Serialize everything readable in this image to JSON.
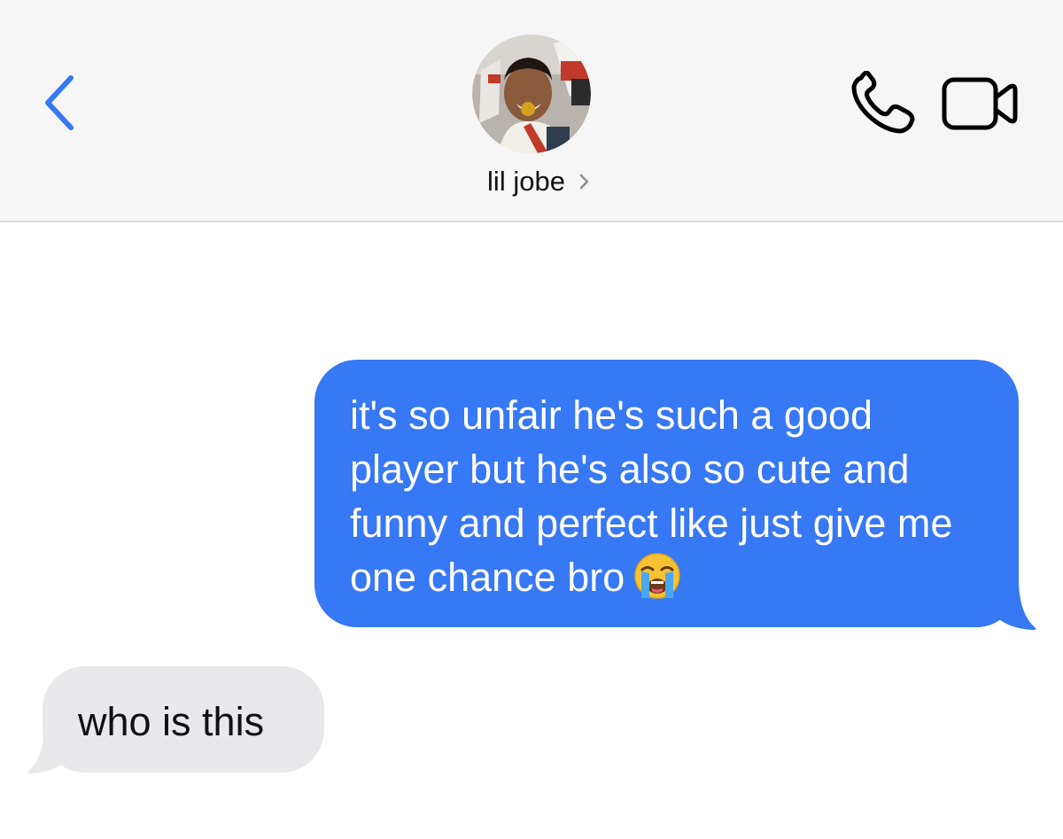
{
  "header": {
    "contact_name": "lil jobe",
    "back_icon": "chevron-left-icon",
    "phone_icon": "phone-icon",
    "video_icon": "video-camera-icon",
    "accent_color": "#3478f6"
  },
  "messages": [
    {
      "direction": "sent",
      "text": "it's so unfair he's such a good player but he's also so cute and funny and perfect like just give me one chance bro",
      "emoji": "loudly-crying-face-emoji",
      "bubble_color": "#3778f4"
    },
    {
      "direction": "received",
      "text": "who is this",
      "bubble_color": "#e9e9eb"
    }
  ]
}
